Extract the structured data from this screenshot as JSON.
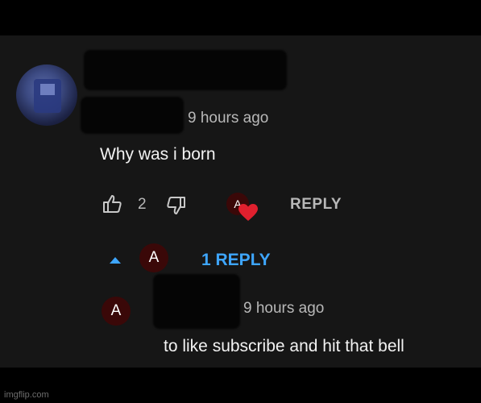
{
  "comment": {
    "time": "9 hours ago",
    "text": "Why was i born",
    "like_count": "2",
    "reply_label": "REPLY"
  },
  "replies_toggle": {
    "label": "1 REPLY"
  },
  "reply": {
    "avatar_letter": "A",
    "time": "9 hours ago",
    "text": "to like subscribe and hit that bell"
  },
  "creator_heart": {
    "avatar_letter": "A"
  },
  "toggle_avatar": {
    "letter": "A"
  },
  "watermark": "imgflip.com",
  "colors": {
    "background": "#161616",
    "link": "#3ea6ff",
    "heart": "#e0202e",
    "avatar_a": "#3a0808"
  }
}
